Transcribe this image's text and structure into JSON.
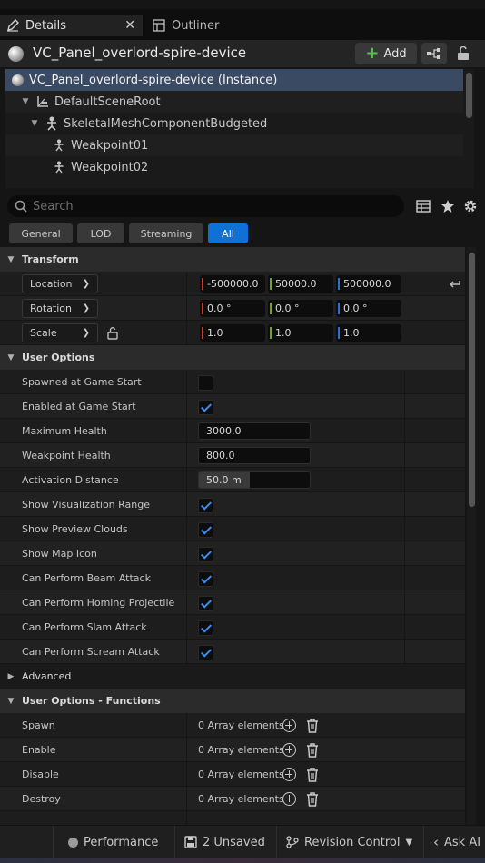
{
  "tabs": [
    {
      "label": "Details",
      "active": true
    },
    {
      "label": "Outliner",
      "active": false
    }
  ],
  "header": {
    "actor_name": "VC_Panel_overlord-spire-device",
    "add_label": "Add"
  },
  "tree": {
    "items": [
      {
        "label": "VC_Panel_overlord-spire-device (Instance)",
        "icon": "sphere-icon",
        "selected": true
      },
      {
        "label": "DefaultSceneRoot",
        "icon": "scene-root-icon"
      },
      {
        "label": "SkeletalMeshComponentBudgeted",
        "icon": "skeleton-icon"
      },
      {
        "label": "Weakpoint01",
        "icon": "socket-icon"
      },
      {
        "label": "Weakpoint02",
        "icon": "socket-icon"
      }
    ]
  },
  "search": {
    "placeholder": "Search"
  },
  "filters": [
    "General",
    "LOD",
    "Streaming",
    "All"
  ],
  "active_filter": "All",
  "transform": {
    "title": "Transform",
    "rows": [
      {
        "mode": "Location",
        "x": "-500000.0",
        "y": "50000.0",
        "z": "500000.0"
      },
      {
        "mode": "Rotation",
        "x": "0.0 °",
        "y": "0.0 °",
        "z": "0.0 °"
      },
      {
        "mode": "Scale",
        "x": "1.0",
        "y": "1.0",
        "z": "1.0"
      }
    ]
  },
  "user_options": {
    "title": "User Options",
    "spawned_at_game_start": {
      "label": "Spawned at Game Start",
      "checked": false
    },
    "enabled_at_game_start": {
      "label": "Enabled at Game Start",
      "checked": true
    },
    "maximum_health": {
      "label": "Maximum Health",
      "value": "3000.0"
    },
    "weakpoint_health": {
      "label": "Weakpoint Health",
      "value": "800.0"
    },
    "activation_distance": {
      "label": "Activation Distance",
      "value": "50.0 m"
    },
    "show_visualization_range": {
      "label": "Show Visualization Range",
      "checked": true
    },
    "show_preview_clouds": {
      "label": "Show Preview Clouds",
      "checked": true
    },
    "show_map_icon": {
      "label": "Show Map Icon",
      "checked": true
    },
    "beam_attack": {
      "label": "Can Perform Beam Attack",
      "checked": true
    },
    "homing_projectile": {
      "label": "Can Perform Homing Projectile",
      "checked": true
    },
    "slam_attack": {
      "label": "Can Perform Slam Attack",
      "checked": true
    },
    "scream_attack": {
      "label": "Can Perform Scream Attack",
      "checked": true
    }
  },
  "advanced": {
    "title": "Advanced"
  },
  "functions": {
    "title": "User Options - Functions",
    "rows": [
      {
        "label": "Spawn",
        "value": "0 Array elements"
      },
      {
        "label": "Enable",
        "value": "0 Array elements"
      },
      {
        "label": "Disable",
        "value": "0 Array elements"
      },
      {
        "label": "Destroy",
        "value": "0 Array elements"
      }
    ]
  },
  "statusbar": {
    "performance": "Performance",
    "unsaved": "2 Unsaved",
    "revision_control": "Revision Control",
    "ask_ai": "Ask AI"
  },
  "colors": {
    "accent": "#0f70d6",
    "selection": "#3a4a62",
    "check": "#3a8ef0"
  }
}
